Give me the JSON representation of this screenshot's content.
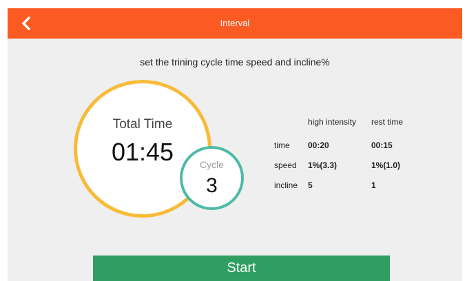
{
  "header": {
    "title": "Interval",
    "back_icon": "chevron-left-icon",
    "color": "#fb5b22"
  },
  "instruction": "set the trining cycle time speed and incline%",
  "total": {
    "label": "Total Time",
    "value": "01:45",
    "ring_color": "#f7bb38"
  },
  "cycle": {
    "label": "Cycle",
    "value": "3",
    "ring_color": "#4dbba6"
  },
  "table": {
    "columns": [
      "high intensity",
      "rest time"
    ],
    "rows": [
      {
        "label": "time",
        "high": "00:20",
        "rest": "00:15"
      },
      {
        "label": "speed",
        "high": "1%(3.3)",
        "rest": "1%(1.0)"
      },
      {
        "label": "incline",
        "high": "5",
        "rest": "1"
      }
    ]
  },
  "start_button": {
    "label": "Start",
    "color": "#2e9f61"
  }
}
